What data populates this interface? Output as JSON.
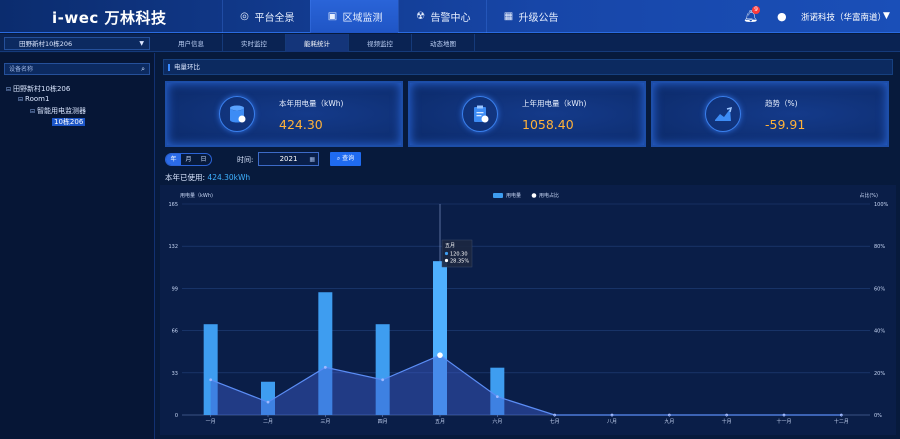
{
  "header": {
    "logo": "i-wec 万林科技",
    "nav": [
      {
        "label": "平台全景",
        "icon": "globe-icon",
        "active": false
      },
      {
        "label": "区域监测",
        "icon": "monitor-icon",
        "active": true
      },
      {
        "label": "告警中心",
        "icon": "radiation-icon",
        "active": false
      },
      {
        "label": "升级公告",
        "icon": "grid-icon",
        "active": false
      }
    ],
    "notification_count": "9",
    "user": "浙诺科技（华富南道）"
  },
  "subbar": {
    "site": "田野新村10栋206",
    "tabs": [
      "用户信息",
      "实时监控",
      "能耗统计",
      "视频监控",
      "动态地图"
    ],
    "active_tab": 2
  },
  "sidebar": {
    "search_placeholder": "设备名称",
    "tree": [
      "田野新村10栋206",
      "Room1",
      "智能用电监测器",
      "10栋206"
    ]
  },
  "main": {
    "section_title": "电量环比",
    "cards": [
      {
        "label": "本年用电量（kWh)",
        "value": "424.30",
        "icon": "database-icon"
      },
      {
        "label": "上年用电量（kWh)",
        "value": "1058.40",
        "icon": "clipboard-icon"
      },
      {
        "label": "趋势（%)",
        "value": "-59.91",
        "icon": "trend-icon"
      }
    ],
    "period_options": [
      "年",
      "月",
      "日"
    ],
    "active_period": 0,
    "time_label": "时间:",
    "year": "2021",
    "query_label": "查询",
    "used_label": "本年已使用:",
    "used_value": "424.30kWh"
  },
  "chart_data": {
    "type": "bar",
    "categories": [
      "一月",
      "二月",
      "三月",
      "四月",
      "五月",
      "六月",
      "七月",
      "八月",
      "九月",
      "十月",
      "十一月",
      "十二月"
    ],
    "series": [
      {
        "name": "用电量",
        "type": "bar",
        "values": [
          71,
          26,
          96,
          71,
          120.3,
          37,
          0,
          0,
          0,
          0,
          0,
          0
        ]
      },
      {
        "name": "用电占比",
        "type": "line",
        "values": [
          16.7,
          6.1,
          22.6,
          16.7,
          28.35,
          8.7,
          0,
          0,
          0,
          0,
          0,
          0
        ]
      }
    ],
    "ylabel": "用电量（kWh)",
    "ylabel_right": "占比(%)",
    "ylim": [
      0,
      165
    ],
    "yticks": [
      0,
      33,
      66,
      99,
      132,
      165
    ],
    "ylim_right": [
      0,
      100
    ],
    "yticks_right": [
      "0%",
      "20%",
      "40%",
      "60%",
      "80%",
      "100%"
    ],
    "tooltip": {
      "title": "五月",
      "bar": "120.30",
      "line": "28.35%"
    },
    "bar_color": "#3e9df0",
    "line_color": "#5b8df5",
    "legend_position": "top-center"
  }
}
